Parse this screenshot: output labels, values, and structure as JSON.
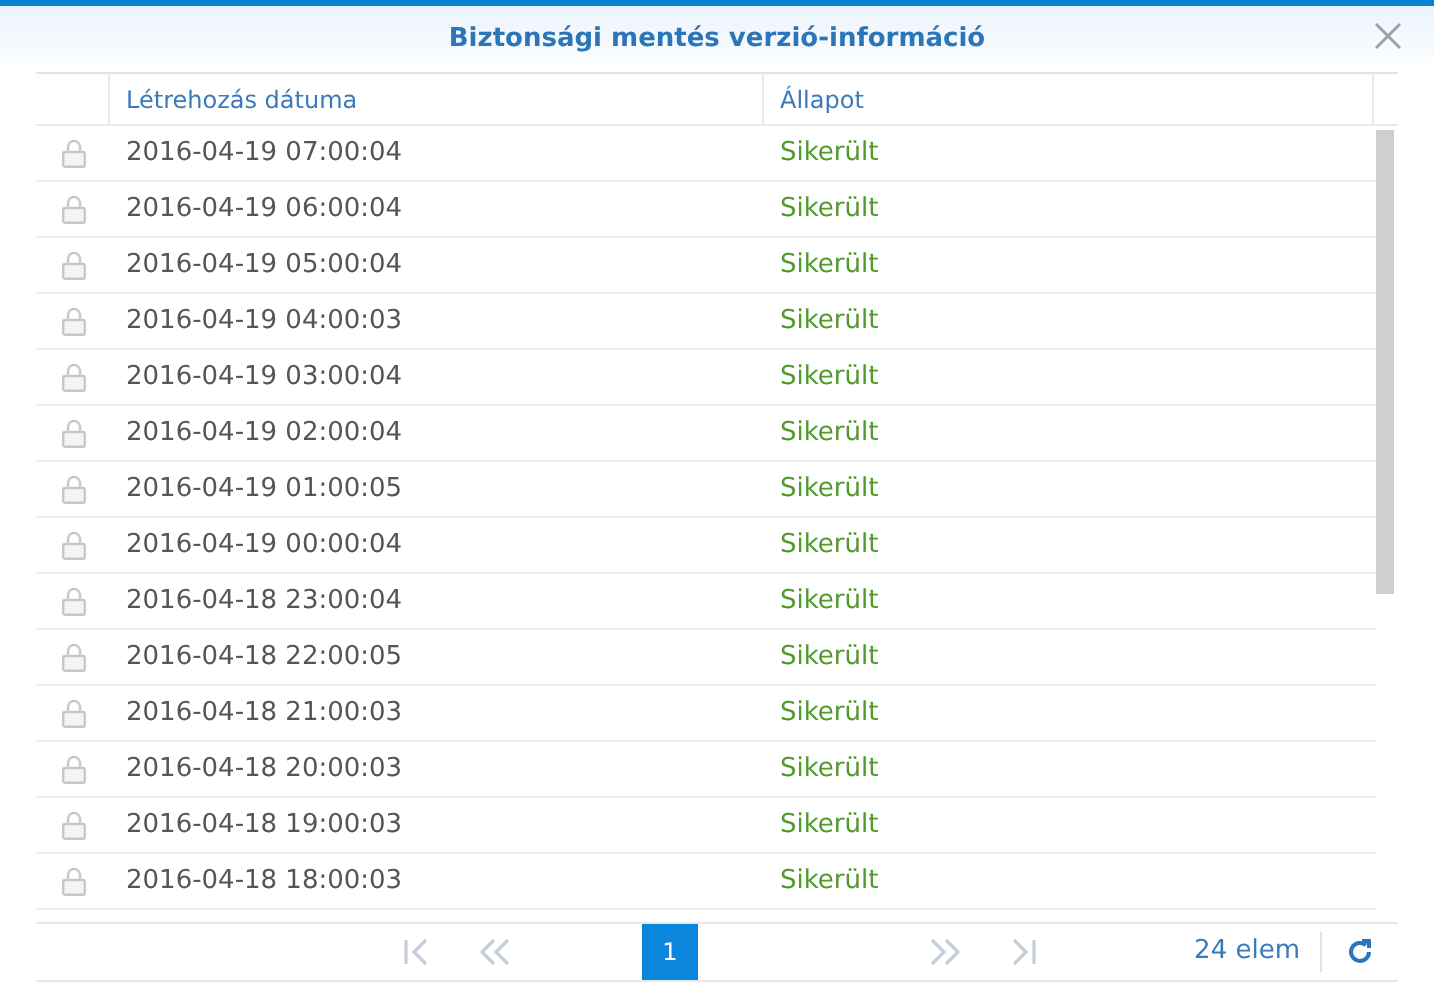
{
  "window": {
    "title": "Biztonsági mentés verzió-információ"
  },
  "table": {
    "columns": [
      "Létrehozás dátuma",
      "Állapot"
    ],
    "rows": [
      {
        "date": "2016-04-19 07:00:04",
        "status": "Sikerült"
      },
      {
        "date": "2016-04-19 06:00:04",
        "status": "Sikerült"
      },
      {
        "date": "2016-04-19 05:00:04",
        "status": "Sikerült"
      },
      {
        "date": "2016-04-19 04:00:03",
        "status": "Sikerült"
      },
      {
        "date": "2016-04-19 03:00:04",
        "status": "Sikerült"
      },
      {
        "date": "2016-04-19 02:00:04",
        "status": "Sikerült"
      },
      {
        "date": "2016-04-19 01:00:05",
        "status": "Sikerült"
      },
      {
        "date": "2016-04-19 00:00:04",
        "status": "Sikerült"
      },
      {
        "date": "2016-04-18 23:00:04",
        "status": "Sikerült"
      },
      {
        "date": "2016-04-18 22:00:05",
        "status": "Sikerült"
      },
      {
        "date": "2016-04-18 21:00:03",
        "status": "Sikerült"
      },
      {
        "date": "2016-04-18 20:00:03",
        "status": "Sikerült"
      },
      {
        "date": "2016-04-18 19:00:03",
        "status": "Sikerült"
      },
      {
        "date": "2016-04-18 18:00:03",
        "status": "Sikerült"
      }
    ]
  },
  "pager": {
    "pages": [
      {
        "label": "1",
        "selected": true
      }
    ],
    "first_disabled": true,
    "prev_disabled": true,
    "next_disabled": true,
    "last_disabled": true,
    "count": "24 elem"
  }
}
